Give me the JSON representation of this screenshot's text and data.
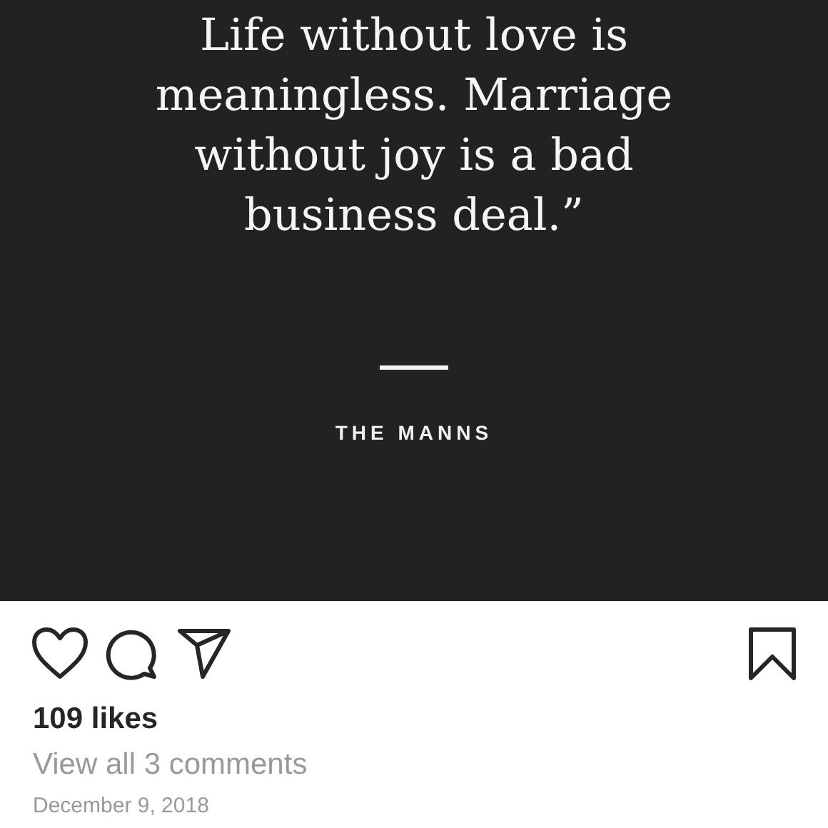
{
  "post_image": {
    "quote_lines": [
      "Life without love is",
      "meaningless. Marriage",
      "without joy is a bad",
      "business deal.”"
    ],
    "author": "THE MANNS"
  },
  "actions": {
    "liked": false,
    "saved": false
  },
  "likes": "109 likes",
  "comments_link": "View all 3 comments",
  "date": "December 9, 2018"
}
